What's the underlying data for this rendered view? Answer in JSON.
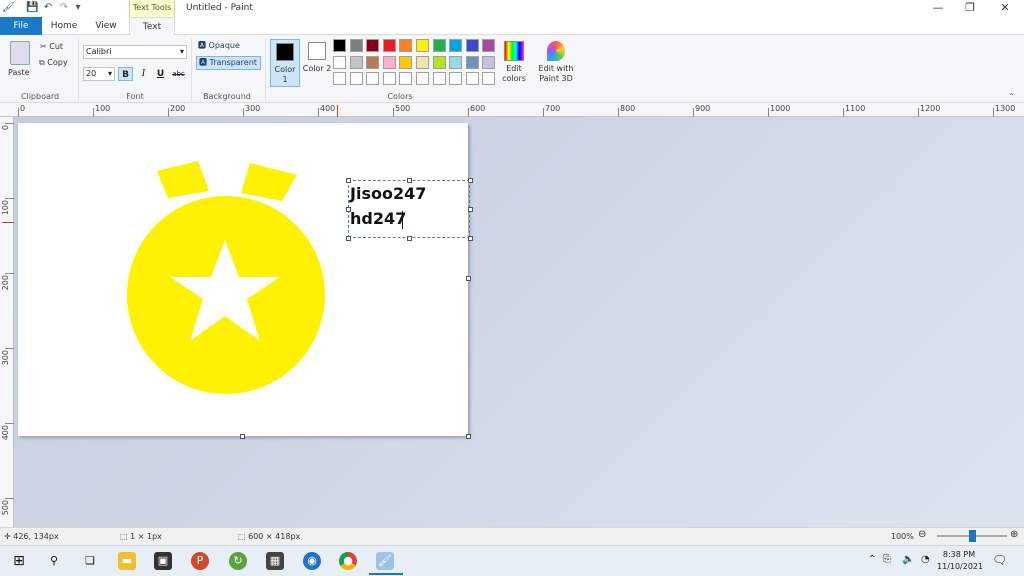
{
  "window": {
    "title": "Untitled - Paint",
    "context_tab": "Text Tools",
    "minimize": "—",
    "restore": "❐",
    "close": "✕"
  },
  "tabs": {
    "file": "File",
    "home": "Home",
    "view": "View",
    "text": "Text"
  },
  "clipboard": {
    "paste": "Paste",
    "cut": "Cut",
    "copy": "Copy",
    "group": "Clipboard"
  },
  "font": {
    "family": "Calibri",
    "size": "20",
    "bold": "B",
    "italic": "I",
    "underline": "U",
    "strike": "abc",
    "group": "Font"
  },
  "background": {
    "opaque": "Opaque",
    "transparent": "Transparent",
    "group": "Background"
  },
  "colors": {
    "color1_label": "Color 1",
    "color2_label": "Color 2",
    "color1": "#000000",
    "color2": "#ffffff",
    "group": "Colors",
    "edit_colors": "Edit colors",
    "edit_paint3d": "Edit with Paint 3D",
    "palette_row1": [
      "#000000",
      "#7f7f7f",
      "#880015",
      "#ed1c24",
      "#ff7f27",
      "#fff200",
      "#22b14c",
      "#00a2e8",
      "#3f48cc",
      "#a349a4"
    ],
    "palette_row2": [
      "#ffffff",
      "#c3c3c3",
      "#b97a57",
      "#ffaec9",
      "#ffc90e",
      "#efe4b0",
      "#b5e61d",
      "#99d9ea",
      "#7092be",
      "#c8bfe7"
    ],
    "palette_row3": [
      "#ffffff",
      "#ffffff",
      "#ffffff",
      "#ffffff",
      "#ffffff",
      "#ffffff",
      "#ffffff",
      "#ffffff",
      "#ffffff",
      "#ffffff"
    ]
  },
  "ruler": {
    "h_labels": [
      "0",
      "100",
      "200",
      "300",
      "400",
      "500",
      "600",
      "700",
      "800",
      "900",
      "1000",
      "1100",
      "1200",
      "1300"
    ],
    "v_labels": [
      "0",
      "100",
      "200",
      "300",
      "400",
      "500"
    ]
  },
  "canvas": {
    "text_line1": "Jisoo247",
    "text_line2": "hd247",
    "medal_color": "#fff200"
  },
  "status": {
    "cursor_pos": "426, 134px",
    "selection_size": "1 × 1px",
    "image_size": "600 × 418px",
    "zoom": "100%",
    "zoom_fraction": 0.5
  },
  "taskbar": {
    "time": "8:38 PM",
    "date": "11/10/2021"
  }
}
